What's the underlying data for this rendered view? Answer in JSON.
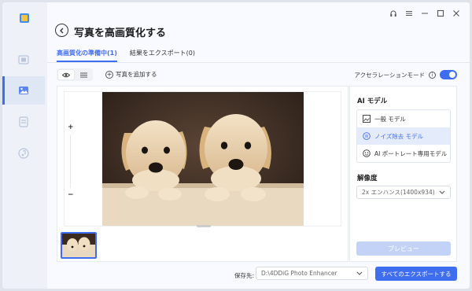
{
  "window": {
    "title": "写真を高画質化する",
    "controls": [
      "headset-icon",
      "menu-icon",
      "minimize-icon",
      "maximize-icon",
      "close-icon"
    ]
  },
  "sidebar": {
    "items": [
      {
        "icon": "video-icon",
        "active": false
      },
      {
        "icon": "photo-icon",
        "active": true
      },
      {
        "icon": "document-icon",
        "active": false
      },
      {
        "icon": "music-icon",
        "active": false
      }
    ]
  },
  "tabs": [
    {
      "label": "高画質化の準備中(1)",
      "active": true
    },
    {
      "label": "結果をエクスポート(0)",
      "active": false
    }
  ],
  "toolbar": {
    "add_photo": "写真を追加する",
    "acceleration_label": "アクセラレーションモード",
    "acceleration_on": true
  },
  "preview": {
    "zoom_plus": "+",
    "zoom_minus": "−"
  },
  "right_panel": {
    "ai_model_title": "AI モデル",
    "models": [
      {
        "label": "一般 モデル",
        "icon": "image-icon",
        "selected": false
      },
      {
        "label": "ノイズ除去 モデル",
        "icon": "denoise-icon",
        "selected": true
      },
      {
        "label": "AI ポートレート専用モデル",
        "icon": "face-icon",
        "selected": false
      }
    ],
    "resolution_title": "解像度",
    "resolution_value": "2x エンハンス(1400x934)",
    "preview_button": "プレビュー"
  },
  "footer": {
    "save_label": "保存先:",
    "save_path": "D:\\4DDiG Photo Enhancer",
    "export_all": "すべてのエクスポートする"
  },
  "colors": {
    "accent": "#3f6df0",
    "selected_bg": "#e4ebfb",
    "disabled_button": "#c3d2f7"
  }
}
